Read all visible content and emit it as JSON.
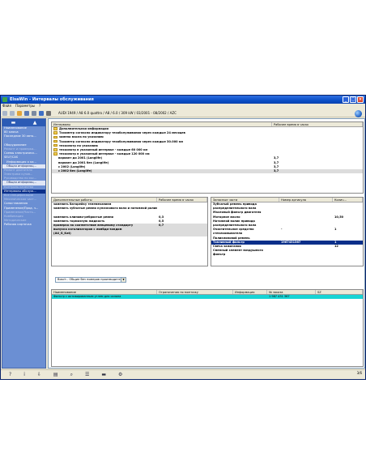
{
  "window": {
    "title": "ElsaWin - Интервалы обслуживания"
  },
  "menu": [
    "Файл",
    "Параметры",
    "?"
  ],
  "toolbar": {
    "vehicle": "AUDI 1949 / A8 6.0 quattro / A8 / 6.0 / 309 kW / 03/2001 - 08/2002 / AZC"
  },
  "nav": {
    "items": [
      {
        "label": "Наименование",
        "style": ""
      },
      {
        "label": "80 ключа",
        "style": ""
      },
      {
        "label": "Последние 30 авто...",
        "style": ""
      },
      {
        "label": "",
        "style": ""
      },
      {
        "label": "Оборудование",
        "style": ""
      },
      {
        "label": "Ремонт и проверка...",
        "style": "dim"
      },
      {
        "label": "Схемы электрическ...",
        "style": ""
      },
      {
        "label": "SELF/CAS",
        "style": ""
      },
      {
        "label": "Информация о ки...",
        "style": "indent"
      },
      {
        "label": "Общая информац...",
        "style": "sub"
      },
      {
        "label": "Ремонт двигателя",
        "style": "dim"
      },
      {
        "label": "Электрика кузов...",
        "style": "dim"
      },
      {
        "label": "Руководство по экс...",
        "style": "dim"
      },
      {
        "label": "Общая информац...",
        "style": "sub"
      },
      {
        "label": "Контроль качества",
        "style": "dim"
      },
      {
        "label": "Интервалы обслуж...",
        "style": "active"
      },
      {
        "label": "Все спецификации",
        "style": "dim"
      },
      {
        "label": "Механическая част...",
        "style": "dim"
      },
      {
        "label": "Сопоставления",
        "style": ""
      },
      {
        "label": "Применение/Прод. ч...",
        "style": ""
      },
      {
        "label": "Применение/Часть...",
        "style": "dim"
      },
      {
        "label": "Комбинация",
        "style": "dim"
      },
      {
        "label": "Методические",
        "style": "dim"
      },
      {
        "label": "Рабочая карточка",
        "style": ""
      }
    ]
  },
  "intervals": {
    "headers": [
      "Интервалы",
      "Рабочее время в часах"
    ],
    "rows": [
      {
        "name": "Дополнительная информация",
        "value": "",
        "folder": true,
        "bold": true
      },
      {
        "name": "Тахометр согласно индикатору техобслуживания через каждые 24 месяцев",
        "value": "",
        "folder": true,
        "bold": true
      },
      {
        "name": "замена масла по указанию",
        "value": "",
        "folder": true,
        "bold": true
      },
      {
        "name": "Тахометр согласно индикатору техобслуживания через каждые 30.000 км",
        "value": "",
        "folder": true,
        "bold": true
      },
      {
        "name": "техосмотр по указанию",
        "value": "",
        "folder": true,
        "bold": true
      },
      {
        "name": "техосмотр в указанный интервал - каждые 60 000 км",
        "value": "",
        "folder": true,
        "bold": true
      },
      {
        "name": "техосмотр в указанный интервал - каждые 120 000 км",
        "value": "",
        "folder": true,
        "bold": true
      },
      {
        "name": "вариант до 2001 (Longlife)",
        "value": "3,7",
        "folder": false,
        "bold": true
      },
      {
        "name": "вариант до 2001 без (Longlife)",
        "value": "3,7",
        "folder": false,
        "bold": true
      },
      {
        "name": "с 2002 (Longlife)",
        "value": "3,7",
        "folder": false,
        "bold": true
      },
      {
        "name": "с 2002 без (Longlife)",
        "value": "3,7",
        "folder": false,
        "bold": true,
        "hl": true
      }
    ]
  },
  "extra_work": {
    "headers": [
      "Дополнительные работы",
      "Рабочее время в часах"
    ],
    "rows": [
      {
        "name": "заменить батарейку телемеханизм",
        "value": "",
        "hl": false
      },
      {
        "name": "заменить зубчатые ремни кулачкового вала и натяжной ролик",
        "value": "",
        "hl": false
      },
      {
        "name": "",
        "value": "",
        "hl": false
      },
      {
        "name": "заменить клиново-ребристые ремни",
        "value": "0,3",
        "hl": false
      },
      {
        "name": "заменить тормозную жидкость",
        "value": "0,5",
        "hl": false
      },
      {
        "name": "проверка на соответствие венцевому стандарту",
        "value": "0,7",
        "hl": true
      },
      {
        "name": "выпуска катализаторов с лямбда-зондом",
        "value": "",
        "hl": true
      },
      {
        "name": "(AU_G_Kat)",
        "value": "",
        "hl": true
      }
    ]
  },
  "parts": {
    "headers": [
      "Запасные части",
      "Номер артикула",
      "Колич..."
    ],
    "rows": [
      {
        "name": "Зубчатый ремень привода",
        "part": "",
        "qty": "",
        "style": ""
      },
      {
        "name": "распределительного вала",
        "part": "",
        "qty": "",
        "style": ""
      },
      {
        "name": "Масляный фильтр двигателя",
        "part": "",
        "qty": "",
        "style": ""
      },
      {
        "name": "Моторное масло",
        "part": "",
        "qty": "10,50",
        "style": ""
      },
      {
        "name": "Натяжной валик привода",
        "part": "",
        "qty": "",
        "style": ""
      },
      {
        "name": "распределительного вала",
        "part": "",
        "qty": "",
        "style": ""
      },
      {
        "name": "Очистительное средство",
        "part": "-",
        "qty": "1",
        "style": ""
      },
      {
        "name": "стеклоомывателя",
        "part": "",
        "qty": "",
        "style": ""
      },
      {
        "name": "Поликлиновой ремень",
        "part": "",
        "qty": "",
        "style": ""
      },
      {
        "name": "Топливный фильтр",
        "part": "1967431367",
        "qty": "1",
        "style": "sel"
      },
      {
        "name": "Свеча зажигания",
        "part": "",
        "qty": "12",
        "style": ""
      },
      {
        "name": "Сменный элемент воздушного",
        "part": "",
        "qty": "",
        "style": ""
      },
      {
        "name": "фильтр",
        "part": "",
        "qty": "",
        "style": ""
      }
    ]
  },
  "supplier_select": {
    "value": "Bosch - Общие без номеров производителя"
  },
  "parts_detail": {
    "headers": [
      "Наименование",
      "Ограничения по монтажу",
      "Информация",
      "№ заказа",
      "SZ"
    ],
    "rows": [
      {
        "name": "Фильтр с активированным углем для салона",
        "restrict": "",
        "info": "",
        "order": "1 987 431 367",
        "sz": ""
      }
    ]
  },
  "bottombar": {
    "page": "3/6"
  },
  "colors": {
    "accent": "#0a2f8a",
    "nav_bg": "#6b8fd3",
    "highlight_row": "#17d4d4"
  }
}
